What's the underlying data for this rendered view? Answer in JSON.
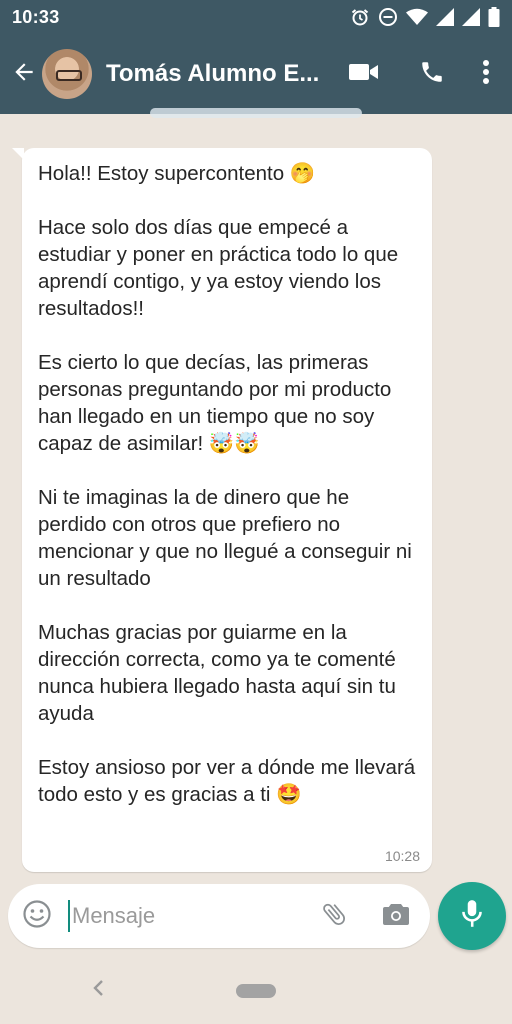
{
  "status_bar": {
    "time": "10:33",
    "icons": [
      "alarm-icon",
      "do-not-disturb-icon",
      "wifi-icon",
      "signal-icon",
      "signal-icon",
      "battery-icon"
    ]
  },
  "header": {
    "contact_name": "Tomás Alumno E...",
    "back_icon": "arrow-left-icon",
    "actions": [
      "video-call-icon",
      "voice-call-icon",
      "more-vert-icon"
    ]
  },
  "message": {
    "text": "Hola!! Estoy supercontento 🤭\n\nHace solo dos días que empecé a estudiar y poner en práctica todo lo que aprendí contigo, y ya estoy viendo los resultados!!\n\nEs cierto lo que decías, las primeras personas preguntando por mi producto han llegado en un tiempo que no soy capaz de asimilar! 🤯🤯\n\nNi te imaginas la de dinero que he perdido con otros que prefiero no mencionar y que no llegué a conseguir ni un resultado\n\nMuchas gracias por guiarme en la dirección correcta, como ya te comenté nunca hubiera llegado hasta aquí sin tu ayuda\n\nEstoy ansioso por ver a dónde me llevará todo esto y es gracias a ti 🤩",
    "time": "10:28"
  },
  "composer": {
    "placeholder": "Mensaje",
    "icons": [
      "emoji-icon",
      "attach-icon",
      "camera-icon",
      "mic-icon"
    ]
  },
  "colors": {
    "header_bg": "#3e5864",
    "chat_bg": "#ece5dd",
    "accent": "#1fa48f"
  }
}
